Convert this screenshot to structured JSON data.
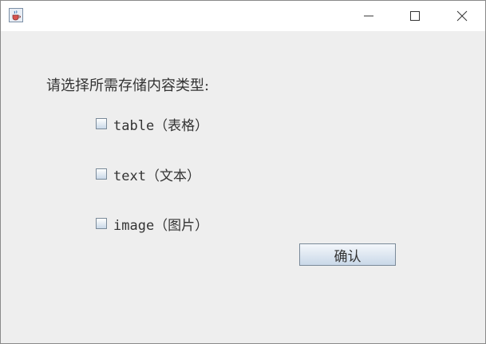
{
  "titlebar": {
    "app_icon": "java-coffee-cup-icon",
    "minimize_icon": "minimize-icon",
    "maximize_icon": "maximize-icon",
    "close_icon": "close-icon"
  },
  "main": {
    "prompt": "请选择所需存储内容类型:",
    "options": [
      {
        "label": "table（表格）",
        "checked": false
      },
      {
        "label": "text（文本）",
        "checked": false
      },
      {
        "label": "image（图片）",
        "checked": false
      }
    ],
    "confirm_label": "确认"
  }
}
